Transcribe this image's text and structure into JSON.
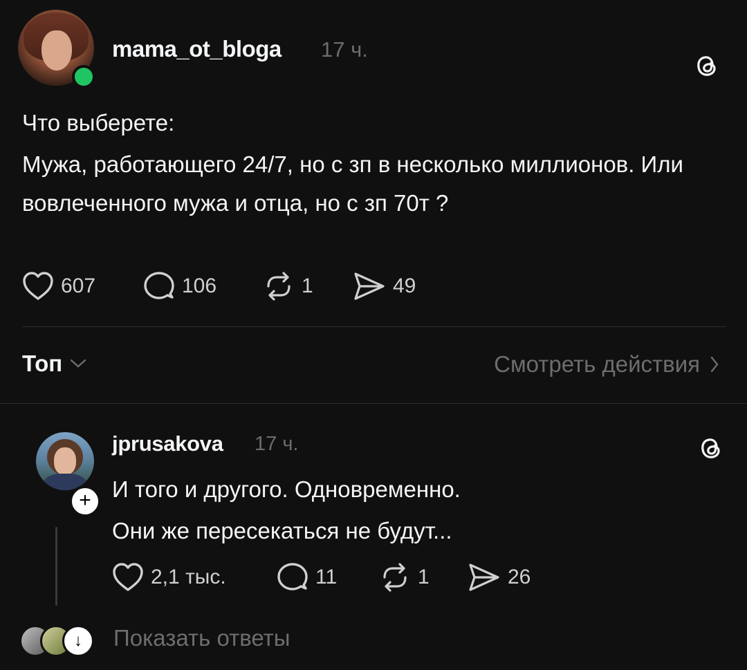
{
  "post": {
    "author": "mama_ot_bloga",
    "time": "17 ч.",
    "body_line1": "Что выберете:",
    "body_line2": "Мужа, работающего 24/7, но с зп в несколько миллионов. Или вовлеченного мужа и отца, но с зп 70т ?",
    "likes": "607",
    "comments": "106",
    "reposts": "1",
    "shares": "49"
  },
  "filter": {
    "sort_label": "Топ",
    "view_activity": "Смотреть действия"
  },
  "reply": {
    "author": "jprusakova",
    "time": "17 ч.",
    "body_line1": "И того и другого. Одновременно.",
    "body_line2": "Они же пересекаться не будут...",
    "likes": "2,1 тыс.",
    "comments": "11",
    "reposts": "1",
    "shares": "26",
    "follow_symbol": "+"
  },
  "replies_link": {
    "label": "Показать ответы"
  },
  "icons": {
    "threads_logo": "threads-icon",
    "like": "heart-icon",
    "comment": "comment-icon",
    "repost": "repost-icon",
    "share": "share-icon",
    "chevron": "chevron-icon"
  },
  "colors": {
    "background": "#101010",
    "text": "#f3f5f7",
    "muted": "#6d6d6d",
    "online": "#1fc463"
  }
}
